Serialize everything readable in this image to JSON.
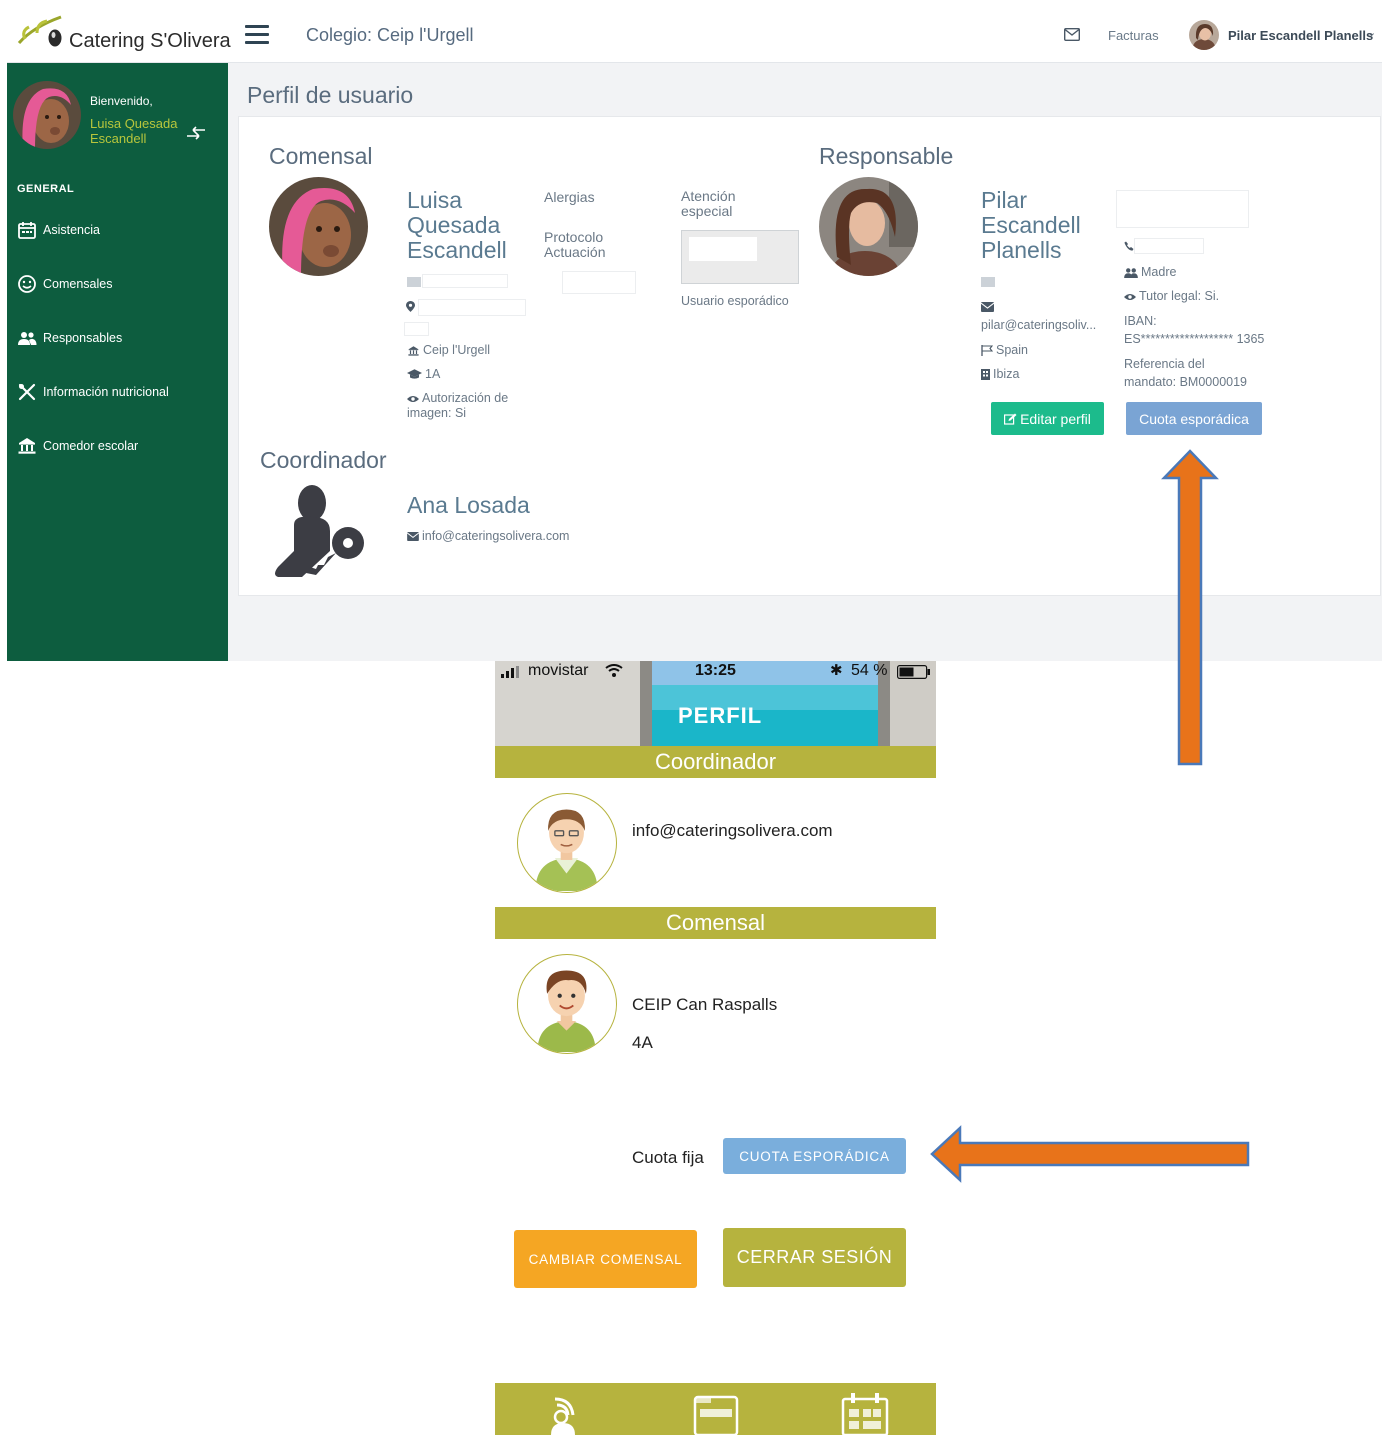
{
  "desktop": {
    "logo_text": "Catering S'Olivera",
    "school_title": "Colegio: Ceip l'Urgell",
    "facturas_label": "Facturas",
    "user_name": "Pilar Escandell Planells",
    "sidebar": {
      "welcome": "Bienvenido,",
      "student_name": "Luisa Quesada Escandell",
      "section_label": "GENERAL",
      "items": [
        {
          "label": "Asistencia",
          "icon": "calendar-icon"
        },
        {
          "label": "Comensales",
          "icon": "smiley-icon"
        },
        {
          "label": "Responsables",
          "icon": "users-icon"
        },
        {
          "label": "Información nutricional",
          "icon": "cutlery-icon"
        },
        {
          "label": "Comedor escolar",
          "icon": "bank-icon"
        }
      ]
    },
    "page_title": "Perfil de usuario",
    "comensal": {
      "section_title": "Comensal",
      "name": "Luisa Quesada Escandell",
      "school": "Ceip l'Urgell",
      "class": "1A",
      "image_auth": "Autorización de imagen: Si",
      "alergias_label": "Alergias",
      "protocolo_label": "Protocolo Actuación",
      "atencion_label": "Atención especial",
      "usuario_esporadico": "Usuario esporádico"
    },
    "responsable": {
      "section_title": "Responsable",
      "name": "Pilar Escandell Planells",
      "email": "pilar@cateringsoliv...",
      "country": "Spain",
      "city": "Ibiza",
      "relation": "Madre",
      "tutor_legal": "Tutor legal: Si.",
      "iban_label": "IBAN:",
      "iban_value": "ES******************* 1365",
      "mandato_label": "Referencia del",
      "mandato_value": "mandato: BM0000019",
      "edit_button": "Editar perfil",
      "cuota_button": "Cuota esporádica"
    },
    "coordinador": {
      "section_title": "Coordinador",
      "name": "Ana Losada",
      "email": "info@cateringsolivera.com"
    }
  },
  "mobile": {
    "status": {
      "carrier": "movistar",
      "time": "13:25",
      "battery": "54 %"
    },
    "header_title": "PERFIL",
    "coordinador_bar": "Coordinador",
    "coordinador_email": "info@cateringsolivera.com",
    "comensal_bar": "Comensal",
    "comensal_school": "CEIP Can Raspalls",
    "comensal_class": "4A",
    "cuota_fija_label": "Cuota fija",
    "cuota_esporadica_button": "CUOTA ESPORÁDICA",
    "cambiar_button": "CAMBIAR COMENSAL",
    "cerrar_button": "CERRAR SESIÓN"
  },
  "colors": {
    "sidebar_green": "#0d5d3f",
    "accent_olive": "#b6b33e",
    "button_teal": "#1cbb8c",
    "button_blue": "#7aa4d4",
    "button_orange": "#f5a623",
    "arrow_orange": "#e8731a",
    "arrow_outline": "#4a79b9"
  }
}
